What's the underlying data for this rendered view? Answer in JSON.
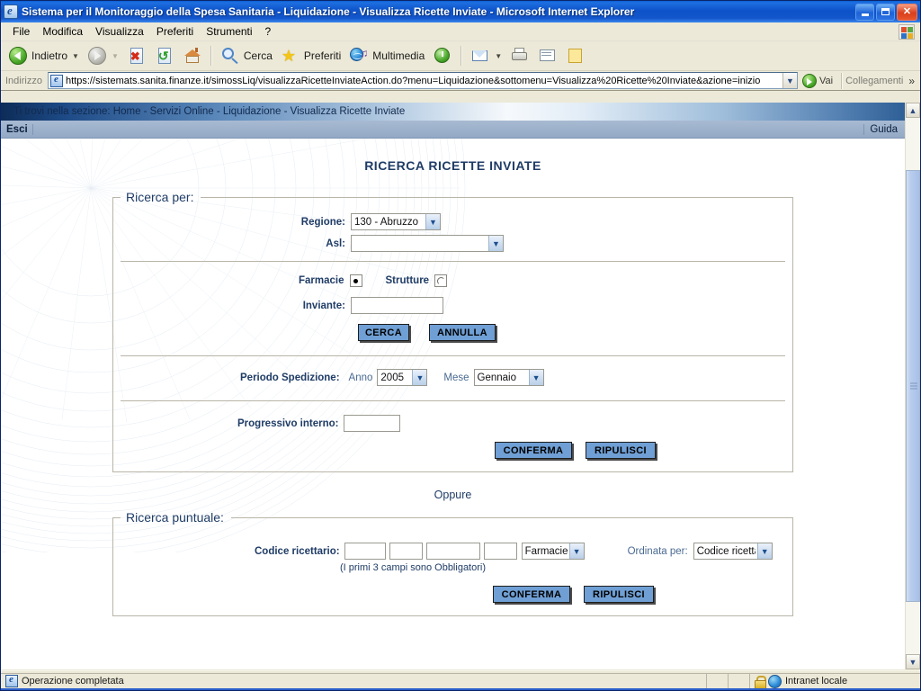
{
  "window": {
    "title": "Sistema per il Monitoraggio della Spesa Sanitaria - Liquidazione - Visualizza Ricette Inviate - Microsoft Internet Explorer",
    "app_icon": "ie-page-icon",
    "minimize_label": "Riduci a icona",
    "restore_label": "Ripristina",
    "close_label": "Chiudi"
  },
  "menu": {
    "items": [
      {
        "label": "File"
      },
      {
        "label": "Modifica"
      },
      {
        "label": "Visualizza"
      },
      {
        "label": "Preferiti"
      },
      {
        "label": "Strumenti"
      },
      {
        "label": "?"
      }
    ]
  },
  "toolbar": {
    "back_label": "Indietro",
    "forward_label": "",
    "search_label": "Cerca",
    "favorites_label": "Preferiti",
    "media_label": "Multimedia",
    "icons": {
      "back": "back-arrow-icon",
      "forward": "forward-arrow-icon",
      "stop": "stop-icon",
      "refresh": "refresh-icon",
      "home": "home-icon",
      "search": "magnifier-icon",
      "favorites": "star-icon",
      "media": "media-globe-icon",
      "history": "history-icon",
      "mail": "mail-icon",
      "print": "printer-icon",
      "edit": "edit-icon",
      "discuss": "notes-icon"
    }
  },
  "address": {
    "label": "Indirizzo",
    "url": "https://sistemats.sanita.finanze.it/simossLiq/visualizzaRicetteInviateAction.do?menu=Liquidazione&sottomenu=Visualizza%20Ricette%20Inviate&azione=inizio",
    "placeholder": "Indirizzo",
    "go_label": "Vai",
    "links_label": "Collegamenti"
  },
  "page": {
    "breadcrumb": "Ti trovi nella sezione: Home - Servizi Online - Liquidazione - Visualizza Ricette Inviate",
    "exit_label": "Esci",
    "help_label": "Guida",
    "title": "RICERCA RICETTE INVIATE",
    "or_separator": "Oppure"
  },
  "search_by": {
    "legend": "Ricerca per:",
    "regione": {
      "label": "Regione:",
      "value": "130 - Abruzzo",
      "options": [
        "130 - Abruzzo"
      ]
    },
    "asl": {
      "label": "Asl:",
      "value": "",
      "options": [
        ""
      ]
    },
    "farmacie": {
      "label": "Farmacie",
      "selected": true
    },
    "strutture": {
      "label": "Strutture",
      "selected": false
    },
    "inviante": {
      "label": "Inviante:",
      "value": "",
      "placeholder": ""
    },
    "cerca_button": "CERCA",
    "annulla_button": "ANNULLA",
    "periodo": {
      "label": "Periodo Spedizione:",
      "anno_label": "Anno",
      "anno_value": "2005",
      "anno_options": [
        "2005"
      ],
      "mese_label": "Mese",
      "mese_value": "Gennaio",
      "mese_options": [
        "Gennaio"
      ]
    },
    "progressivo": {
      "label": "Progressivo interno:",
      "value": "",
      "placeholder": ""
    },
    "conferma_button": "CONFERMA",
    "ripulisci_button": "RIPULISCI"
  },
  "point_search": {
    "legend": "Ricerca puntuale:",
    "codice_label": "Codice ricettario:",
    "codice_fields": [
      "",
      "",
      "",
      ""
    ],
    "tipo": {
      "value": "Farmacie",
      "options": [
        "Farmacie",
        "Strutture"
      ]
    },
    "ordinata_label": "Ordinata per:",
    "ordinata": {
      "value": "Codice ricetta",
      "options": [
        "Codice ricetta"
      ]
    },
    "hint": "(I primi 3 campi sono Obbligatori)",
    "conferma_button": "CONFERMA",
    "ripulisci_button": "RIPULISCI"
  },
  "statusbar": {
    "message": "Operazione completata",
    "zone": "Intranet locale",
    "lock_icon": "lock-icon",
    "zone_icon": "globe-icon"
  },
  "colors": {
    "titlebar_blue": "#0d52c8",
    "button_blue": "#6f9fd4",
    "heading_navy": "#1f3c66",
    "escibar_blue": "#9cafc9",
    "chrome_beige": "#ece9d8"
  }
}
